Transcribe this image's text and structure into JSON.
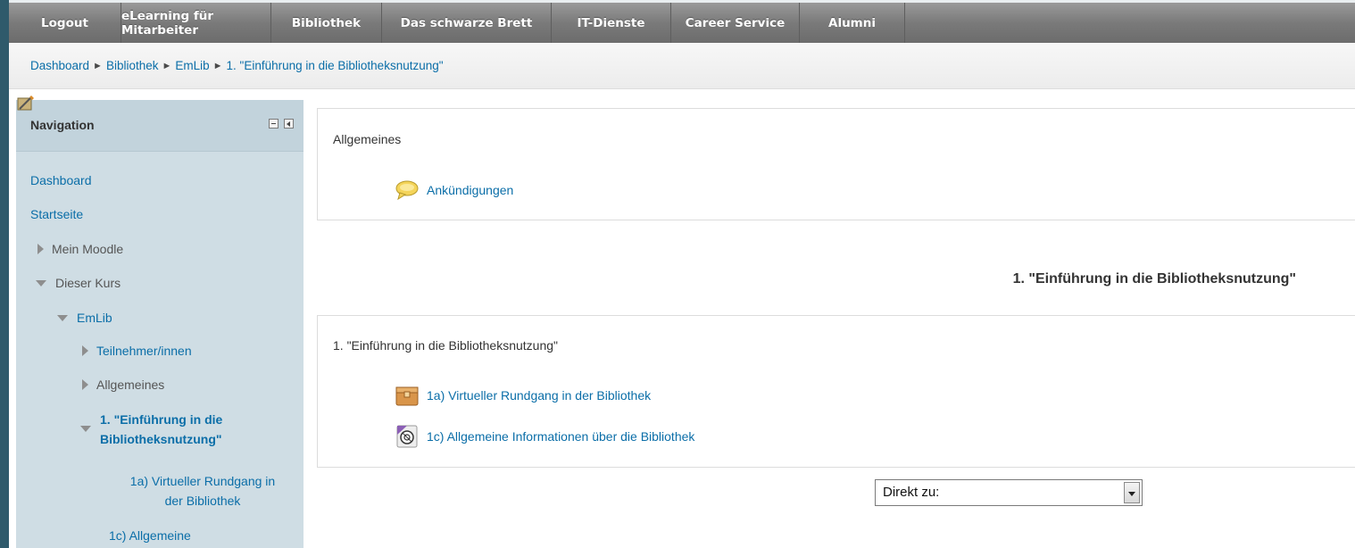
{
  "topnav": {
    "items": [
      "Logout",
      "eLearning für Mitarbeiter",
      "Bibliothek",
      "Das schwarze Brett",
      "IT-Dienste",
      "Career Service",
      "Alumni"
    ]
  },
  "breadcrumb": {
    "items": [
      "Dashboard",
      "Bibliothek",
      "EmLib",
      "1. \"Einführung in die Bibliotheksnutzung\""
    ],
    "separator": "►"
  },
  "sidebar": {
    "title": "Navigation",
    "items": [
      {
        "label": "Dashboard"
      },
      {
        "label": "Startseite"
      },
      {
        "label": "Mein Moodle"
      },
      {
        "label": "Dieser Kurs"
      },
      {
        "label": "EmLib"
      },
      {
        "label": "Teilnehmer/innen"
      },
      {
        "label": "Allgemeines"
      },
      {
        "label": "1. \"Einführung in die",
        "label2": "Bibliotheksnutzung\""
      },
      {
        "label": "1a) Virtueller Rundgang in",
        "label2": "der Bibliothek"
      },
      {
        "label": "1c) Allgemeine"
      }
    ]
  },
  "main": {
    "general_section": {
      "title": "Allgemeines",
      "activity": "Ankündigungen"
    },
    "section_heading": "1. \"Einführung in die Bibliotheksnutzung\"",
    "topic_section": {
      "title": "1. \"Einführung in die Bibliotheksnutzung\"",
      "activities": [
        {
          "label": "1a) Virtueller Rundgang in der Bibliothek",
          "icon": "package-icon"
        },
        {
          "label": "1c) Allgemeine Informationen über die Bibliothek",
          "icon": "scorm-icon"
        }
      ]
    },
    "jump_select": "Direkt zu:"
  }
}
